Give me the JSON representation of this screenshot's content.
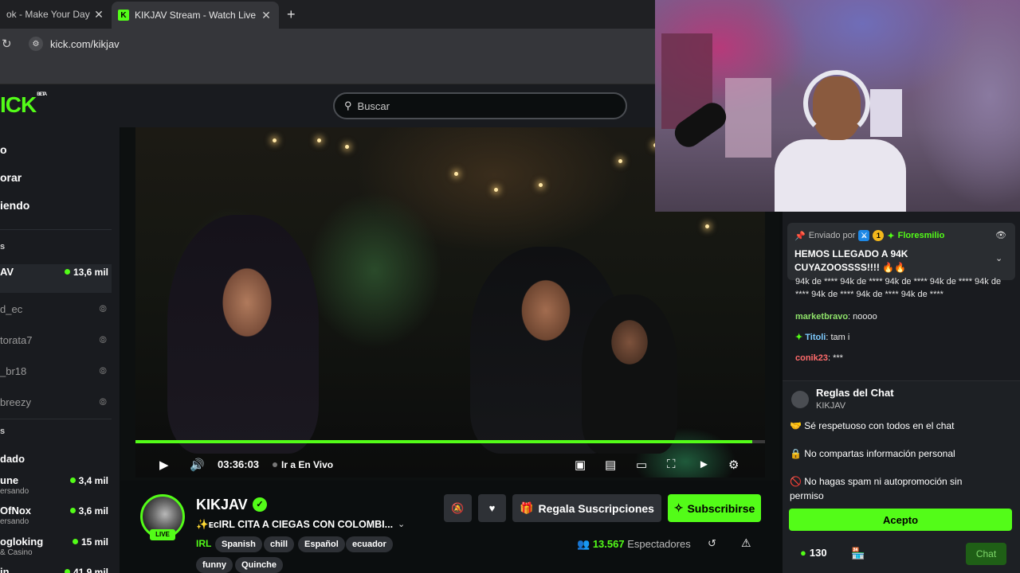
{
  "browser": {
    "tabs": [
      {
        "title": "ok - Make Your Day",
        "close": "✕"
      },
      {
        "title": "KIKJAV Stream - Watch Live on",
        "close": "✕",
        "favicon": "K"
      }
    ],
    "new_tab": "+",
    "url": "kick.com/kikjav"
  },
  "header": {
    "logo": "ICK",
    "logo_sup": "BETA",
    "search_placeholder": "Buscar"
  },
  "sidebar": {
    "nav": [
      "o",
      "orar",
      "iendo"
    ],
    "section_following": "s",
    "section_recommended": "dado",
    "followed": [
      {
        "name": "AV",
        "viewers": "13,6 mil",
        "live": true
      },
      {
        "name": "d_ec",
        "live": false
      },
      {
        "name": "torata7",
        "live": false
      },
      {
        "name": "_br18",
        "live": false
      },
      {
        "name": "breezy",
        "live": false
      }
    ],
    "recommended": [
      {
        "name": "une",
        "sub": "ersando",
        "viewers": "3,4 mil"
      },
      {
        "name": "OfNox",
        "sub": "ersando",
        "viewers": "3,6 mil"
      },
      {
        "name": "ogloking",
        "sub": "& Casino",
        "viewers": "15 mil"
      },
      {
        "name": "in",
        "sub": "",
        "viewers": "41,9 mil"
      }
    ]
  },
  "player": {
    "time": "03:36:03",
    "go_live": "Ir a En Vivo",
    "progress": 0.98
  },
  "stream": {
    "channel": "KIKJAV",
    "title": "✨ᴇᴄIRL CITA A CIEGAS CON COLOMBI...",
    "category": "IRL",
    "tags": [
      "Spanish",
      "chill",
      "Español",
      "ecuador",
      "funny",
      "Quinche"
    ],
    "live_badge": "LIVE",
    "gift_button": "Regala Suscripciones",
    "subscribe_button": "Subscribirse",
    "viewers": "13.567",
    "viewers_label": "Espectadores"
  },
  "chat": {
    "pinned": {
      "sent_by": "Enviado por",
      "badge_number": "1",
      "user": "Floresmilio",
      "message": "HEMOS LLEGADO A 94K CUYAZOOSSSS!!!! 🔥🔥"
    },
    "spam_text": "94k de **** 94k de **** 94k de **** 94k de **** 94k de **** 94k de **** 94k de **** 94k de ****",
    "messages": [
      {
        "user": "marketbravo",
        "text": "noooo",
        "color": "#8fe36a"
      },
      {
        "user": "Titoli",
        "text": "tam i",
        "color": "#7ecbff"
      },
      {
        "user": "conik23",
        "text": "***",
        "color": "#ff6b6b"
      }
    ],
    "rules": {
      "title": "Reglas del Chat",
      "channel": "KIKJAV",
      "items": [
        "🤝 Sé respetuoso con todos en el chat",
        "🔒 No compartas información personal",
        "🚫 No hagas spam ni autopromoción sin permiso"
      ],
      "accept": "Acepto"
    },
    "points": "130",
    "chat_button": "Chat"
  },
  "colors": {
    "accent": "#53fc18",
    "background": "#0b0e0f",
    "panel": "#191b1f"
  }
}
